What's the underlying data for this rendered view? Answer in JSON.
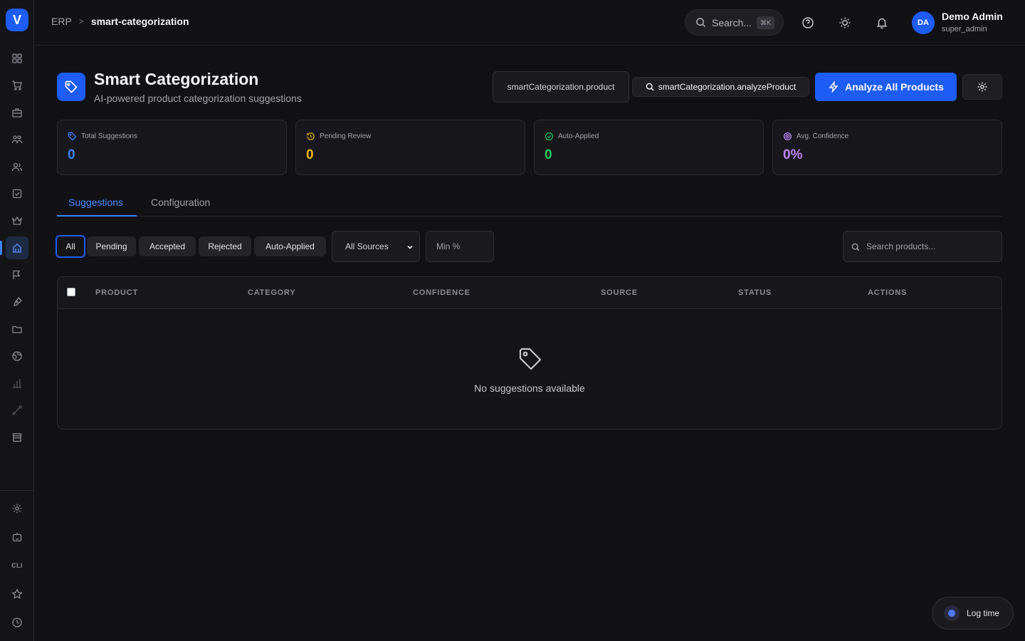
{
  "sidebar": {
    "logo": "V",
    "cli_label": "CLI"
  },
  "topbar": {
    "breadcrumb_root": "ERP",
    "breadcrumb_separator": ">",
    "breadcrumb_current": "smart-categorization",
    "search_placeholder": "Search...",
    "search_shortcut": "⌘K",
    "user_initials": "DA",
    "user_name": "Demo Admin",
    "user_role": "super_admin"
  },
  "header": {
    "title": "Smart Categorization",
    "subtitle": "AI-powered product categorization suggestions",
    "permission_1": "smartCategorization.product",
    "permission_2": "smartCategorization.analyzeProduct",
    "analyze_button": "Analyze All Products"
  },
  "stats": [
    {
      "label": "Total Suggestions",
      "value": "0",
      "color": "#3b82f6"
    },
    {
      "label": "Pending Review",
      "value": "0",
      "color": "#eab308"
    },
    {
      "label": "Auto-Applied",
      "value": "0",
      "color": "#22c55e"
    },
    {
      "label": "Avg. Confidence",
      "value": "0%",
      "color": "#c084fc"
    }
  ],
  "tabs": {
    "suggestions": "Suggestions",
    "configuration": "Configuration"
  },
  "filters": {
    "all": "All",
    "pending": "Pending",
    "accepted": "Accepted",
    "rejected": "Rejected",
    "auto_applied": "Auto-Applied",
    "source_select": "All Sources",
    "min_placeholder": "Min %",
    "search_placeholder": "Search products..."
  },
  "table": {
    "columns": [
      "PRODUCT",
      "CATEGORY",
      "CONFIDENCE",
      "SOURCE",
      "STATUS",
      "ACTIONS"
    ],
    "empty_text": "No suggestions available"
  },
  "log_time": "Log time"
}
